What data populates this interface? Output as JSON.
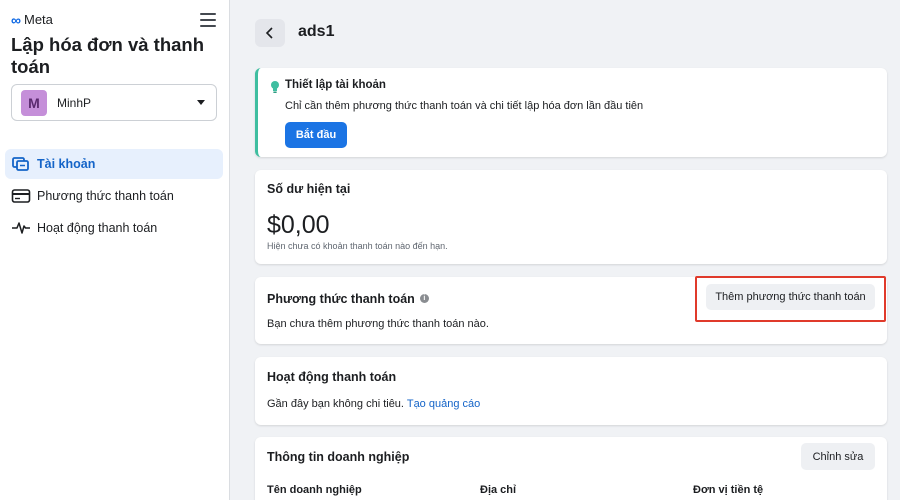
{
  "sidebar": {
    "brand": "Meta",
    "title": "Lập hóa đơn và thanh toán",
    "account": {
      "initial": "M",
      "name": "MinhP"
    },
    "items": [
      {
        "label": "Tài khoản",
        "icon": "accounts-icon",
        "active": true
      },
      {
        "label": "Phương thức thanh toán",
        "icon": "credit-card-icon",
        "active": false
      },
      {
        "label": "Hoạt động thanh toán",
        "icon": "activity-pulse-icon",
        "active": false
      }
    ]
  },
  "header": {
    "title": "ads1"
  },
  "setup": {
    "title": "Thiết lập tài khoản",
    "text": "Chỉ cần thêm phương thức thanh toán và chi tiết lập hóa đơn lần đầu tiên",
    "button": "Bắt đầu"
  },
  "balance": {
    "title": "Số dư hiện tại",
    "amount": "$0,00",
    "note": "Hiện chưa có khoản thanh toán nào đến hạn."
  },
  "payment_methods": {
    "title": "Phương thức thanh toán",
    "text": "Bạn chưa thêm phương thức thanh toán nào.",
    "button": "Thêm phương thức thanh toán"
  },
  "activity": {
    "title": "Hoạt động thanh toán",
    "text": "Gần đây bạn không chi tiêu.",
    "link": "Tạo quảng cáo"
  },
  "business": {
    "title": "Thông tin doanh nghiệp",
    "button": "Chỉnh sửa",
    "columns": [
      "Tên doanh nghiệp",
      "Địa chỉ",
      "Đơn vị tiền tệ"
    ]
  },
  "colors": {
    "accent": "#1b74e4",
    "highlight": "#e03a2b",
    "setup_border": "#3fbea0"
  }
}
